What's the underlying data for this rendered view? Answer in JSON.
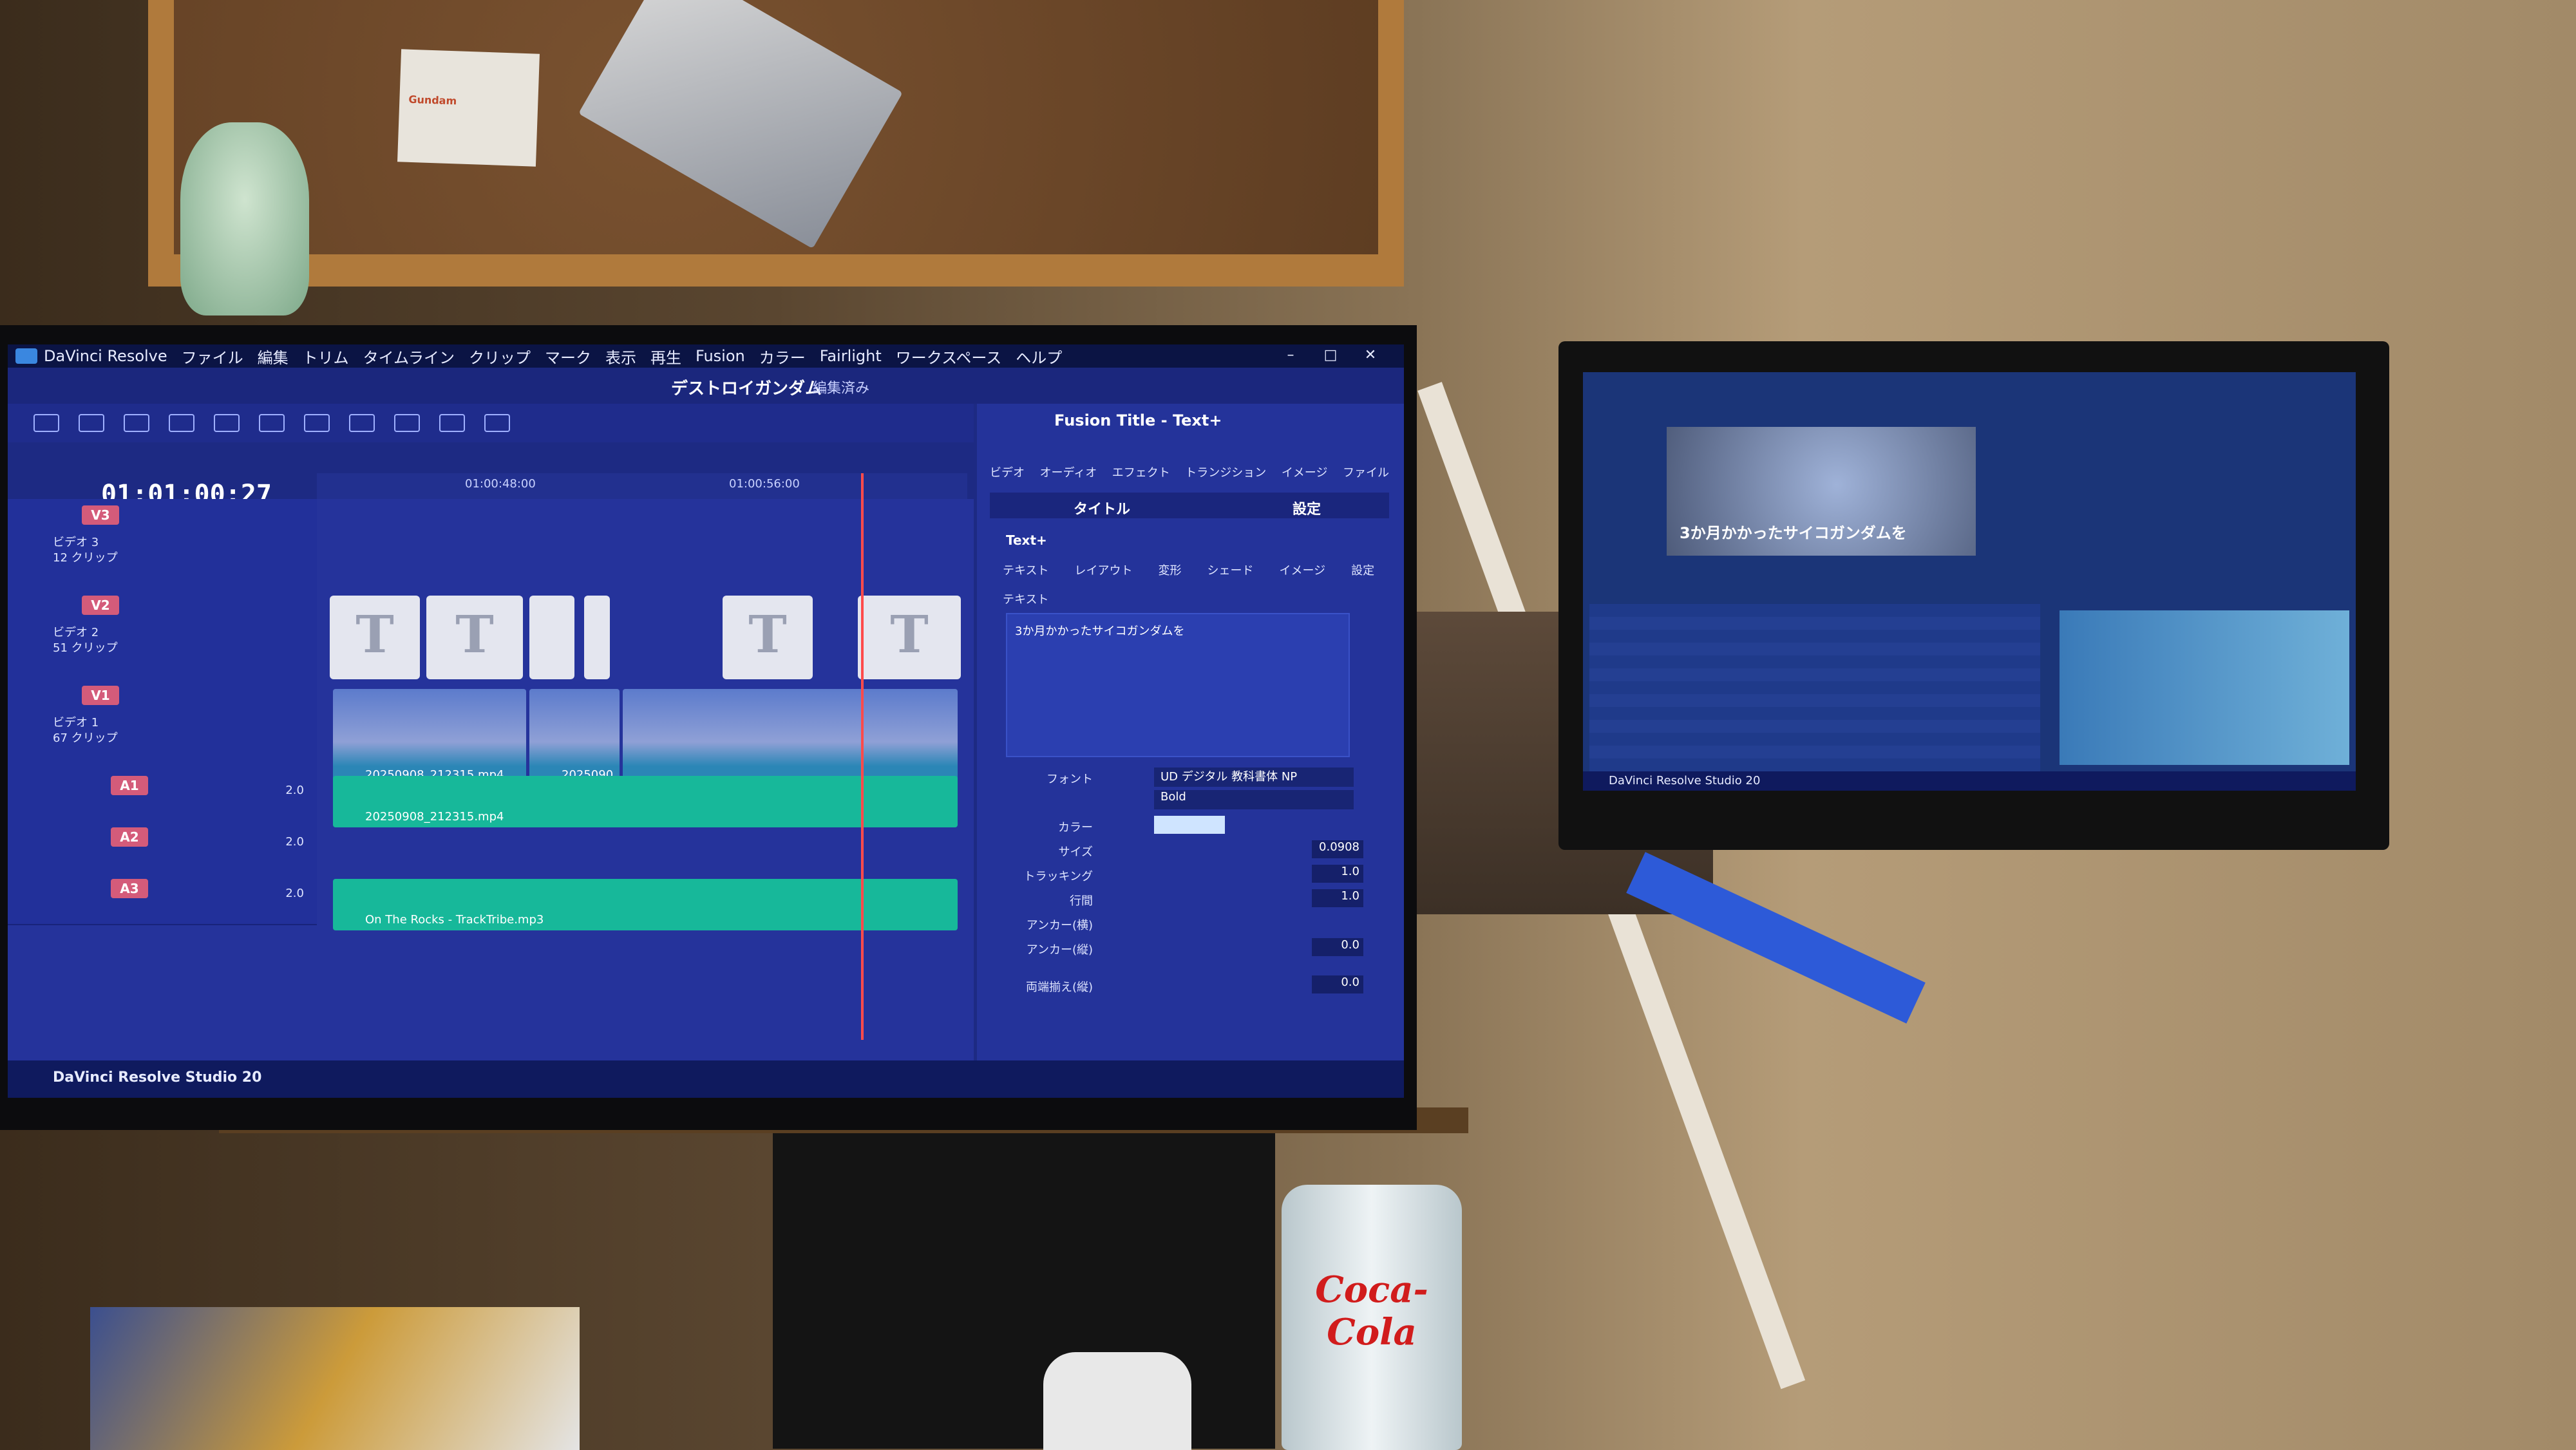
{
  "app": {
    "menu": [
      "DaVinci Resolve",
      "ファイル",
      "編集",
      "トリム",
      "タイムライン",
      "クリップ",
      "マーク",
      "表示",
      "再生",
      "Fusion",
      "カラー",
      "Fairlight",
      "ワークスペース",
      "ヘルプ"
    ],
    "project_title": "デストロイガンダム",
    "project_state": "編集済み",
    "timecode": "01:01:00:27",
    "ruler": [
      "01:00:48:00",
      "01:00:56:00"
    ],
    "tracks": {
      "v3": {
        "badge": "V3",
        "name": "ビデオ 3",
        "clips": "12 クリップ"
      },
      "v2": {
        "badge": "V2",
        "name": "ビデオ 2",
        "clips": "51 クリップ"
      },
      "v1": {
        "badge": "V1",
        "name": "ビデオ 1",
        "clips": "67 クリップ"
      },
      "a1": {
        "badge": "A1",
        "vol": "2.0"
      },
      "a2": {
        "badge": "A2",
        "vol": "2.0"
      },
      "a3": {
        "badge": "A3",
        "vol": "2.0"
      }
    },
    "clip_t": "T",
    "clip_v1": "20250908_212315.mp4",
    "clip_v2": "2025090...",
    "clip_a1": "20250908_212315.mp4",
    "clip_a3": "On The Rocks - TrackTribe.mp3",
    "inspector": {
      "title": "Fusion Title - Text+",
      "tabs": [
        "ビデオ",
        "オーディオ",
        "エフェクト",
        "トランジション",
        "イメージ",
        "ファイル"
      ],
      "seg_left": "タイトル",
      "seg_right": "設定",
      "node": "Text+",
      "subtabs": [
        "テキスト",
        "レイアウト",
        "変形",
        "シェード",
        "イメージ",
        "設定"
      ],
      "section": "テキスト",
      "text": "3か月かかったサイコガンダムを",
      "font_label": "フォント",
      "font": "UD デジタル 教科書体 NP",
      "style": "Bold",
      "color_label": "カラー",
      "size_label": "サイズ",
      "size": "0.0908",
      "tracking_label": "トラッキング",
      "tracking": "1.0",
      "line_label": "行間",
      "line": "1.0",
      "anchor_h": "アンカー(横)",
      "anchor_v": "アンカー(縦)",
      "anchor_v_val": "0.0",
      "both_label": "両端揃え(縦)",
      "both_val": "0.0"
    },
    "brand": "DaVinci Resolve Studio 20"
  },
  "side_monitor": {
    "caption": "3か月かかったサイコガンダムを",
    "footer": "DaVinci Resolve Studio 20"
  },
  "room": {
    "sticker": "Coca-Cola",
    "note": "Gundam"
  }
}
